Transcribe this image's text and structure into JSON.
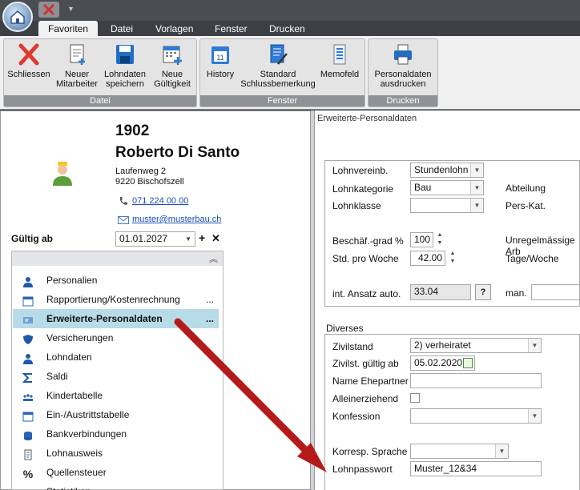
{
  "ribbon": {
    "tabs": [
      "Favoriten",
      "Datei",
      "Vorlagen",
      "Fenster",
      "Drucken"
    ],
    "groups": {
      "datei": "Datei",
      "fenster": "Fenster",
      "drucken": "Drucken"
    },
    "buttons": {
      "schliessen": "Schliessen",
      "neuer1": "Neuer",
      "neuer2": "Mitarbeiter",
      "lohn1": "Lohndaten",
      "lohn2": "speichern",
      "neue1": "Neue",
      "neue2": "Gültigkeit",
      "history": "History",
      "standard1": "Standard",
      "standard2": "Schlussbemerkung",
      "memofeld": "Memofeld",
      "personal1": "Personaldaten",
      "personal2": "ausdrucken"
    }
  },
  "employee": {
    "number": "1902",
    "name": "Roberto Di Santo",
    "street": "Laufenweg 2",
    "city": "9220 Bischofszell",
    "phone": "071 224 00 00",
    "email": "muster@musterbau.ch"
  },
  "gueltig": {
    "label": "Gültig ab",
    "value": "01.01.2027"
  },
  "nav": {
    "items": [
      {
        "label": "Personalien",
        "icon": "person-icon"
      },
      {
        "label": "Rapportierung/Kostenrechnung",
        "icon": "calendar-icon",
        "dots": "..."
      },
      {
        "label": "Erweiterte-Personaldaten",
        "icon": "card-icon",
        "dots": "...",
        "selected": true
      },
      {
        "label": "Versicherungen",
        "icon": "shield-icon"
      },
      {
        "label": "Lohndaten",
        "icon": "person-icon"
      },
      {
        "label": "Saldi",
        "icon": "sigma-icon"
      },
      {
        "label": "Kindertabelle",
        "icon": "people-icon"
      },
      {
        "label": "Ein-/Austrittstabelle",
        "icon": "calendar-icon"
      },
      {
        "label": "Bankverbindungen",
        "icon": "coins-icon"
      },
      {
        "label": "Lohnausweis",
        "icon": "document-icon"
      },
      {
        "label": "Quellensteuer",
        "icon": "percent-icon"
      },
      {
        "label": "Statistiken",
        "icon": "chart-icon"
      }
    ]
  },
  "panel": {
    "title": "Erweiterte-Personaldaten",
    "lohnvereinb_label": "Lohnvereinb.",
    "lohnvereinb_value": "Stundenlohn",
    "lohnkategorie_label": "Lohnkategorie",
    "lohnkategorie_value": "Bau",
    "lohnklasse_label": "Lohnklasse",
    "abteilung_label": "Abteilung",
    "perskat_label": "Pers-Kat.",
    "grad_label": "Beschäf.-grad %",
    "grad_value": "100",
    "std_label": "Std. pro Woche",
    "std_value": "42.00",
    "unreg_label": "Unregelmässige Arb",
    "tage_label": "Tage/Woche",
    "ansatz_label": "int. Ansatz auto.",
    "ansatz_value": "33.04",
    "help": "?",
    "man_label": "man.",
    "diverses_label": "Diverses",
    "zivilstand_label": "Zivilstand",
    "zivilstand_value": "2) verheiratet",
    "zivgueltig_label": "Zivilst. gültig ab",
    "zivgueltig_value": "05.02.2020",
    "ehepartner_label": "Name Ehepartner",
    "allein_label": "Alleinerziehend",
    "konfession_label": "Konfession",
    "sprache_label": "Korresp. Sprache",
    "passwort_label": "Lohnpasswort",
    "passwort_value": "Muster_12&34"
  },
  "colors": {
    "arrow": "#b51a1a",
    "selected_bg": "#b8dbe8",
    "ribbon_group_label": "#8f9296"
  }
}
